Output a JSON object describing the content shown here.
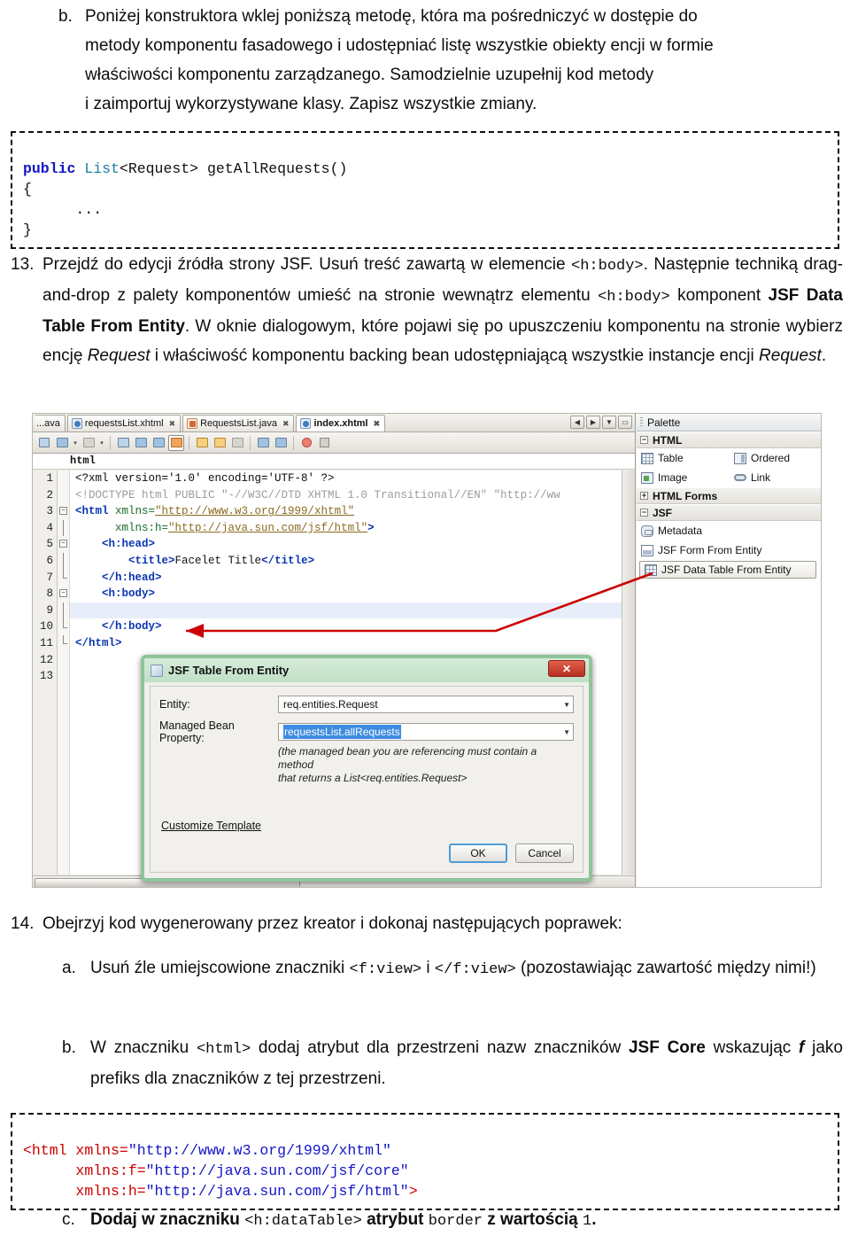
{
  "item_b": {
    "marker": "b.",
    "text_line1": "Poniżej konstruktora wklej poniższą metodę, która ma pośredniczyć w dostępie do",
    "text_line2": "metody komponentu fasadowego i udostępniać listę wszystkie obiekty encji w formie",
    "text_line3": "właściwości komponentu zarządzanego. Samodzielnie uzupełnij kod metody",
    "text_line4": "i zaimportuj wykorzystywane klasy. Zapisz wszystkie zmiany."
  },
  "code_method": {
    "kw_public": "public",
    "type_list": "List",
    "rest_sig": "<Request> getAllRequests()",
    "line_open": "{",
    "line_dots": "      ...",
    "line_close": "}"
  },
  "item_13": {
    "marker": "13.",
    "seg1": "Przejdź do edycji źródła strony JSF. Usuń treść zawartą w elemencie ",
    "code1": "<h:body>",
    "seg2": ". Następnie techniką drag-and-drop z palety komponentów umieść na stronie wewnątrz elementu ",
    "code2": "<h:body>",
    "seg3": " komponent ",
    "bold1": "JSF Data Table From Entity",
    "seg4": ". W oknie dialogowym, które pojawi się po upuszczeniu komponentu na stronie wybierz encję ",
    "ital1": "Request",
    "seg5": " i właściwość komponentu backing bean udostępniającą wszystkie instancje encji ",
    "ital2": "Request",
    "seg6": "."
  },
  "screenshot": {
    "tabs": [
      {
        "label": "...ava",
        "icon": "java-file-icon",
        "active": false,
        "clipped": true,
        "close": ""
      },
      {
        "label": "requestsList.xhtml",
        "icon": "xhtml-file-icon",
        "active": false,
        "clipped": false,
        "close": "✖"
      },
      {
        "label": "RequestsList.java",
        "icon": "java-file-icon",
        "active": false,
        "clipped": false,
        "close": "✖"
      },
      {
        "label": "index.xhtml",
        "icon": "xhtml-file-icon",
        "active": true,
        "clipped": false,
        "close": "✖"
      }
    ],
    "tab_nav": [
      {
        "name": "scroll-left-button",
        "glyph": "◀"
      },
      {
        "name": "scroll-right-button",
        "glyph": "▶"
      },
      {
        "name": "tab-list-dropdown-button",
        "glyph": "▼"
      },
      {
        "name": "maximize-button",
        "glyph": "▭"
      }
    ],
    "toolbar_icons": [
      "last-edit-icon",
      "back-icon",
      "back-dropdown-icon",
      "forward-icon",
      "forward-dropdown-icon",
      "find-selection-icon",
      "previous-match-icon",
      "next-match-icon",
      "toggle-highlight-icon",
      "previous-bookmark-icon",
      "next-bookmark-icon",
      "toggle-bookmark-icon",
      "shift-left-icon",
      "shift-right-icon",
      "start-macro-recording-icon",
      "stop-macro-icon"
    ],
    "breadcrumb": "html",
    "editor": {
      "lines": [
        {
          "n": "1",
          "fold": "",
          "segs": [
            {
              "t": "<?xml version='1.0' encoding='UTF-8' ?>",
              "c": "c-pi"
            }
          ]
        },
        {
          "n": "2",
          "fold": "",
          "segs": [
            {
              "t": "<!DOCTYPE html PUBLIC \"-//W3C//DTD XHTML 1.0 Transitional//EN\" \"http://ww",
              "c": "c-doc"
            }
          ]
        },
        {
          "n": "3",
          "fold": "minus",
          "segs": [
            {
              "t": "<html ",
              "c": "c-tag"
            },
            {
              "t": "xmlns=",
              "c": "c-att"
            },
            {
              "t": "\"http://www.w3.org/1999/xhtml\"",
              "c": "c-url"
            }
          ]
        },
        {
          "n": "4",
          "fold": "line",
          "segs": [
            {
              "t": "      ",
              "c": "c-txt"
            },
            {
              "t": "xmlns:h=",
              "c": "c-att"
            },
            {
              "t": "\"http://java.sun.com/jsf/html\"",
              "c": "c-url"
            },
            {
              "t": ">",
              "c": "c-tag"
            }
          ]
        },
        {
          "n": "5",
          "fold": "minus",
          "segs": [
            {
              "t": "    <h:head>",
              "c": "c-tag"
            }
          ]
        },
        {
          "n": "6",
          "fold": "line",
          "segs": [
            {
              "t": "        <title>",
              "c": "c-tag"
            },
            {
              "t": "Facelet Title",
              "c": "c-txt"
            },
            {
              "t": "</title>",
              "c": "c-tag"
            }
          ]
        },
        {
          "n": "7",
          "fold": "end",
          "segs": [
            {
              "t": "    </h:head>",
              "c": "c-tag"
            }
          ]
        },
        {
          "n": "8",
          "fold": "minus",
          "segs": [
            {
              "t": "    <h:body>",
              "c": "c-tag"
            }
          ]
        },
        {
          "n": "9",
          "fold": "line",
          "segs": [
            {
              "t": "",
              "c": "c-txt"
            }
          ],
          "highlight": true
        },
        {
          "n": "10",
          "fold": "end",
          "segs": [
            {
              "t": "    </h:body>",
              "c": "c-tag"
            }
          ]
        },
        {
          "n": "11",
          "fold": "end2",
          "segs": [
            {
              "t": "</html>",
              "c": "c-tag"
            }
          ]
        },
        {
          "n": "12",
          "fold": "",
          "segs": [
            {
              "t": "",
              "c": "c-txt"
            }
          ]
        },
        {
          "n": "13",
          "fold": "",
          "segs": [
            {
              "t": "",
              "c": "c-txt"
            }
          ]
        }
      ]
    },
    "palette": {
      "title": "Palette",
      "sections": [
        {
          "name": "HTML",
          "expander": "−",
          "rows": [
            [
              {
                "label": "Table",
                "icon": "table-icon"
              },
              {
                "label": "Ordered",
                "icon": "ordered-list-icon"
              }
            ],
            [
              {
                "label": "Image",
                "icon": "image-icon"
              },
              {
                "label": "Link",
                "icon": "link-icon"
              }
            ]
          ]
        },
        {
          "name": "HTML Forms",
          "expander": "+",
          "rows": []
        },
        {
          "name": "JSF",
          "expander": "−",
          "rows": [
            [
              {
                "label": "Metadata",
                "icon": "metadata-icon"
              }
            ],
            [
              {
                "label": "JSF Form From Entity",
                "icon": "jsf-form-icon"
              }
            ]
          ],
          "selected": {
            "label": "JSF Data Table From Entity",
            "icon": "table-icon"
          }
        }
      ]
    },
    "dialog": {
      "title": "JSF Table From Entity",
      "close_glyph": "✕",
      "entity_label": "Entity:",
      "entity_value": "req.entities.Request",
      "bean_label": "Managed Bean Property:",
      "bean_value": "requestsList.allRequests",
      "hint_line1": "(the managed bean you are referencing must contain a method",
      "hint_line2": "that returns a List<req.entities.Request>",
      "customize_link": "Customize Template",
      "ok_label": "OK",
      "cancel_label": "Cancel"
    }
  },
  "item_14": {
    "marker": "14.",
    "text": "Obejrzyj kod wygenerowany przez kreator i dokonaj następujących poprawek:"
  },
  "item_14a": {
    "marker": "a.",
    "seg1": "Usuń źle umiejscowione znaczniki ",
    "code1": "<f:view>",
    "seg2": " i ",
    "code2": "</f:view>",
    "seg3": " (pozostawiając zawartość między nimi!)"
  },
  "item_14b": {
    "marker": "b.",
    "seg1": "W znaczniku ",
    "code1": "<html>",
    "seg2": " dodaj atrybut dla przestrzeni nazw znaczników ",
    "bold1": "JSF Core",
    "seg3": " wskazując ",
    "ital1": "f",
    "seg4": " jako prefiks dla znaczników z tej przestrzeni."
  },
  "code_xmlns": {
    "l1_tag": "<html ",
    "l1_attr": "xmlns=",
    "l1_val": "\"http://www.w3.org/1999/xhtml\"",
    "l2_attr": "xmlns:f=",
    "l2_val": "\"http://java.sun.com/jsf/core\"",
    "l3_attr": "xmlns:h=",
    "l3_val": "\"http://java.sun.com/jsf/html\"",
    "l3_close": ">"
  },
  "item_14c": {
    "marker": "c.",
    "seg1": "Dodaj w znaczniku ",
    "code1": "<h:dataTable>",
    "seg2": " atrybut ",
    "code2": "border",
    "seg3": " z wartością ",
    "code3": "1",
    "seg4": "."
  },
  "colors": {
    "code_keyword": "#1414c8",
    "code_type": "#1a7fa0",
    "code_tag_red": "#cc0000",
    "arrow_red": "#cc0000",
    "dialog_border_green": "#8fc49a",
    "selection_blue": "#3d8ce0"
  }
}
